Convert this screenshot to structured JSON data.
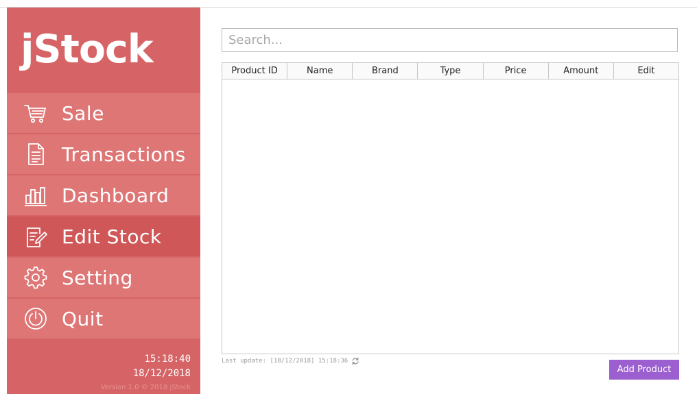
{
  "app": {
    "logo": "jStock"
  },
  "sidebar": {
    "items": [
      {
        "label": "Sale",
        "icon": "cart-icon",
        "active": false
      },
      {
        "label": "Transactions",
        "icon": "document-icon",
        "active": false
      },
      {
        "label": "Dashboard",
        "icon": "bar-chart-icon",
        "active": false
      },
      {
        "label": "Edit Stock",
        "icon": "edit-icon",
        "active": true
      },
      {
        "label": "Setting",
        "icon": "gear-icon",
        "active": false
      },
      {
        "label": "Quit",
        "icon": "power-icon",
        "active": false
      }
    ],
    "time": "15:18:40",
    "date": "18/12/2018",
    "version": "Version 1.0 © 2018 jStock"
  },
  "search": {
    "placeholder": "Search...",
    "value": ""
  },
  "table": {
    "columns": [
      "Product ID",
      "Name",
      "Brand",
      "Type",
      "Price",
      "Amount",
      "Edit"
    ],
    "rows": []
  },
  "status": {
    "last_update": "Last update: [18/12/2018] 15:18:36"
  },
  "actions": {
    "add_product": "Add Product"
  },
  "colors": {
    "sidebar": "#d66466",
    "nav_item": "#de7676",
    "nav_active": "#cf5758",
    "button": "#9b5fcf"
  }
}
